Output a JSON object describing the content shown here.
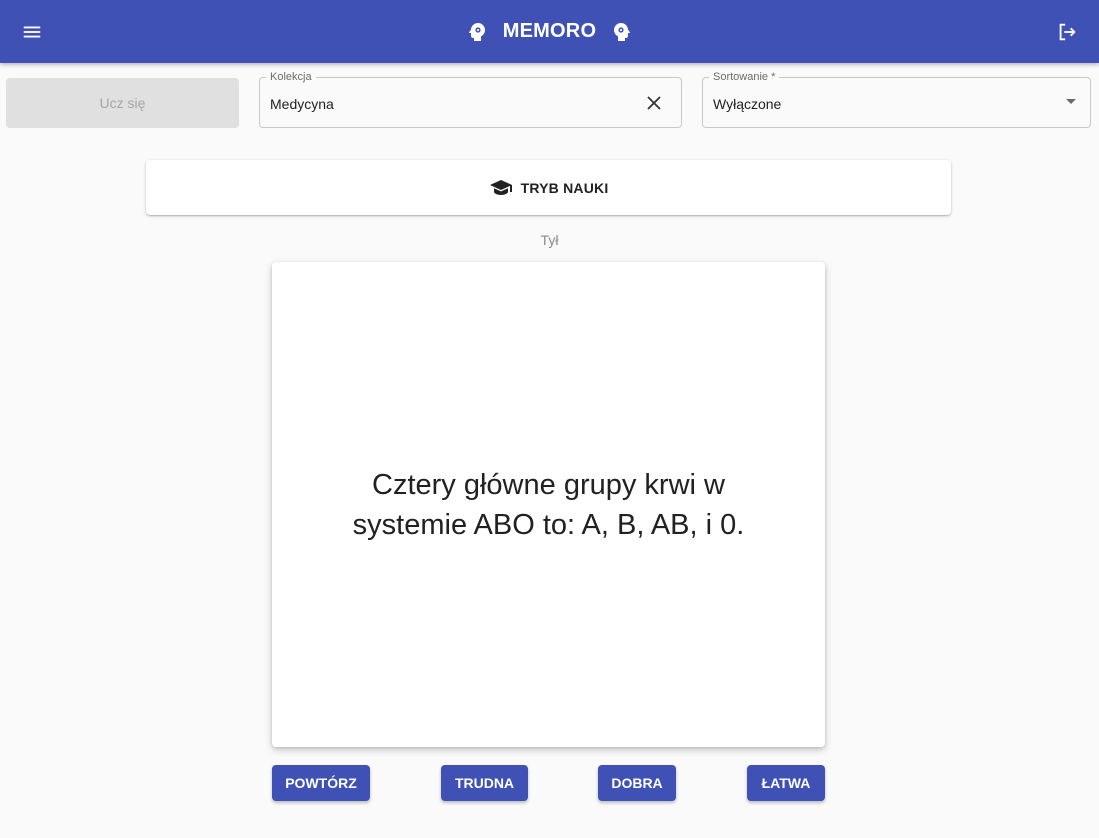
{
  "header": {
    "title": "MEMORO",
    "menu_icon": "menu-icon",
    "brand_icon": "brain-head-icon",
    "logout_icon": "logout-icon"
  },
  "toolbar": {
    "learn_label": "Ucz się",
    "collection": {
      "label": "Kolekcja",
      "value": "Medycyna"
    },
    "sorting": {
      "label": "Sortowanie *",
      "value": "Wyłączone"
    }
  },
  "mode": {
    "title": "TRYB NAUKI",
    "icon": "graduation-cap-icon"
  },
  "card": {
    "side_label": "Tył",
    "text": "Cztery główne grupy krwi w systemie ABO to: A, B, AB, i 0."
  },
  "ratings": {
    "repeat": "POWTÓRZ",
    "hard": "TRUDNA",
    "good": "DOBRA",
    "easy": "ŁATWA"
  },
  "colors": {
    "primary": "#3f51b5",
    "background": "#fafafa",
    "disabled_button": "#e0e0e0"
  }
}
